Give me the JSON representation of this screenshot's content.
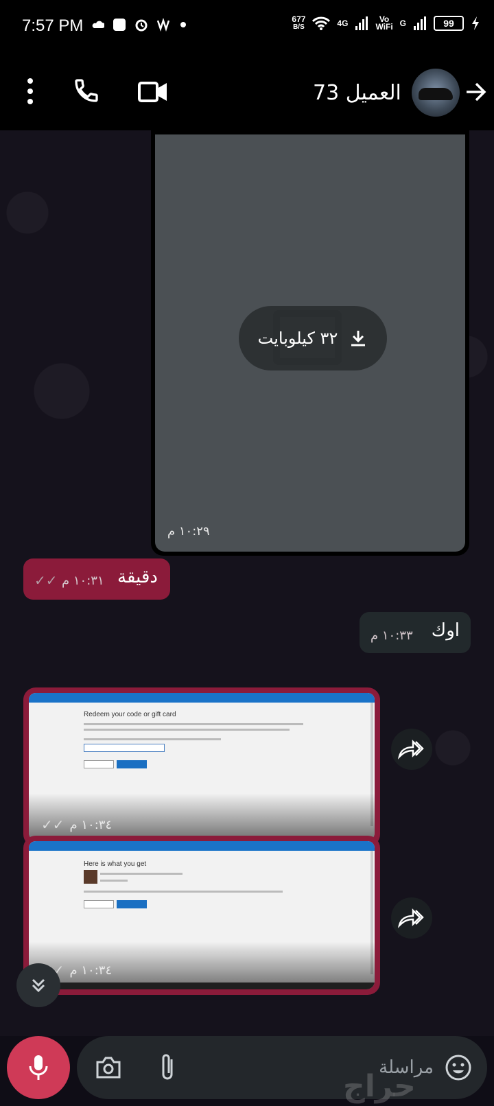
{
  "status_bar": {
    "time": "7:57 PM",
    "speed": "677",
    "speed_unit": "B/S",
    "network_4g": "4G",
    "vo": "Vo",
    "wifi_label": "WiFi",
    "network_g": "G",
    "battery": "99"
  },
  "header": {
    "contact_name": "العميل 73"
  },
  "messages": {
    "image_top": {
      "size": "٣٢ كيلوبايت",
      "time": "١٠:٢٩ م"
    },
    "in_1": {
      "text": "دقيقة",
      "time": "١٠:٣١ م"
    },
    "out_1": {
      "text": "اوك",
      "time": "١٠:٣٣ م"
    },
    "shot_1": {
      "time": "١٠:٣٤ م",
      "page_title": "Redeem your code or gift card"
    },
    "shot_2": {
      "time": "١٠:٣٤ م",
      "page_title": "Here is what you get"
    }
  },
  "compose": {
    "placeholder": "مراسلة"
  },
  "watermark": "حراج",
  "colors": {
    "incoming_bubble": "#8b1b3a",
    "outgoing_bubble": "#22292c",
    "mic_button": "#cf3a57"
  }
}
